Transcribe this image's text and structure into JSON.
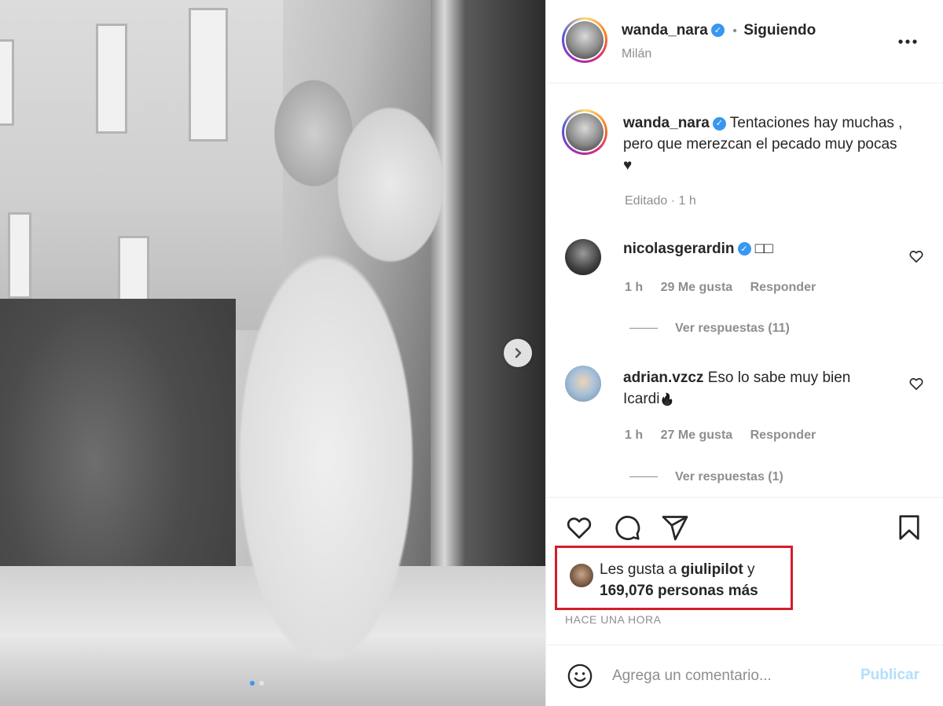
{
  "post": {
    "author": "wanda_nara",
    "follow_separator": "•",
    "follow_state": "Siguiendo",
    "location": "Milán",
    "more_icon": "more-horizontal-icon",
    "caption_line1": "Tentaciones hay muchas ,",
    "caption_line2": "pero que merezcan el pecado muy pocas",
    "caption_heart": "♥",
    "caption_meta": "Editado · 1 h"
  },
  "comments": [
    {
      "username": "nicolasgerardin",
      "verified": true,
      "text": "□□",
      "time": "1 h",
      "likes": "29 Me gusta",
      "reply": "Responder",
      "view_replies": "Ver respuestas (11)"
    },
    {
      "username": "adrian.vzcz",
      "verified": false,
      "text_line1": "Eso lo sabe muy bien",
      "text_line2": "Icardi",
      "text_emoji": "🔥",
      "time": "1 h",
      "likes": "27 Me gusta",
      "reply": "Responder",
      "view_replies": "Ver respuestas (1)"
    }
  ],
  "likes": {
    "prefix": "Les gusta a",
    "user": "giulipilot",
    "connector": "y",
    "count": "169,076 personas más"
  },
  "timestamp": "HACE UNA HORA",
  "composer": {
    "placeholder": "Agrega un comentario...",
    "publish_label": "Publicar"
  },
  "carousel": {
    "slides": 2,
    "active": 1
  },
  "colors": {
    "verified": "#3897f0",
    "highlight_box": "#d21f2b",
    "publish_disabled": "#b2dffc"
  }
}
